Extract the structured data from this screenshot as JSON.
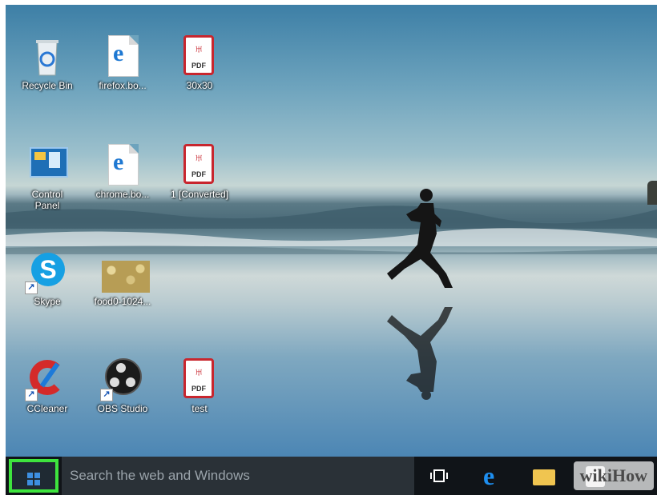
{
  "desktop": {
    "icons": [
      {
        "label": "Recycle Bin",
        "icon": "recycle-bin-icon"
      },
      {
        "label": "firefox.bo...",
        "icon": "edge-document-icon"
      },
      {
        "label": "30x30",
        "icon": "pdf-icon"
      },
      {
        "label": "Control Panel",
        "icon": "control-panel-icon"
      },
      {
        "label": "chrome.bo...",
        "icon": "edge-document-icon"
      },
      {
        "label": "1 [Converted]",
        "icon": "pdf-icon"
      },
      {
        "label": "Skype",
        "icon": "skype-icon"
      },
      {
        "label": "food0-1024...",
        "icon": "image-thumbnail-icon"
      },
      {
        "label": "CCleaner",
        "icon": "ccleaner-icon"
      },
      {
        "label": "OBS Studio",
        "icon": "obs-icon"
      },
      {
        "label": "test",
        "icon": "pdf-icon"
      }
    ],
    "pdf_tag": "PDF"
  },
  "taskbar": {
    "search_placeholder": "Search the web and Windows",
    "edge_glyph": "e",
    "highlight_color": "#3ee43e"
  },
  "watermark": "wikiHow"
}
